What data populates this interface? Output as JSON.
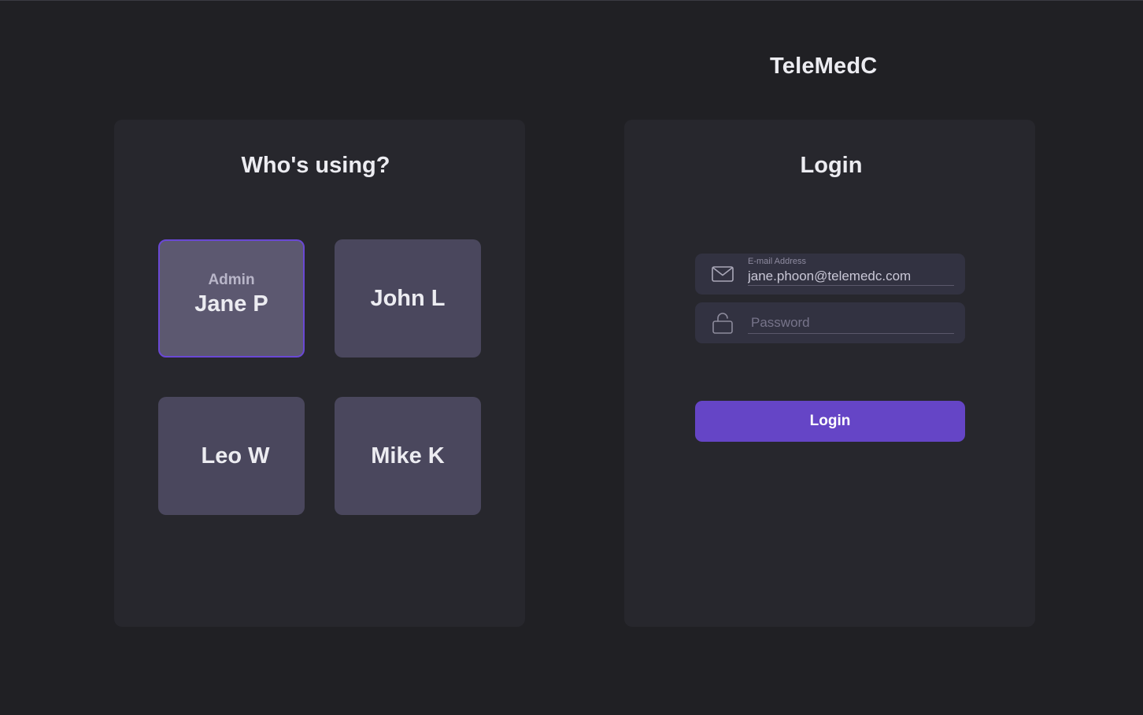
{
  "app": {
    "brand": "TeleMedC"
  },
  "profiles_panel": {
    "title": "Who's using?",
    "profiles": [
      {
        "role": "Admin",
        "name": "Jane P",
        "selected": true
      },
      {
        "role": "",
        "name": "John L",
        "selected": false
      },
      {
        "role": "",
        "name": "Leo W",
        "selected": false
      },
      {
        "role": "",
        "name": "Mike K",
        "selected": false
      }
    ]
  },
  "login_panel": {
    "title": "Login",
    "email": {
      "label": "E-mail Address",
      "value": "jane.phoon@telemedc.com",
      "icon": "envelope-icon"
    },
    "password": {
      "placeholder": "Password",
      "value": "",
      "icon": "unlock-icon"
    },
    "button_label": "Login"
  },
  "colors": {
    "background": "#202024",
    "panel": "#27272d",
    "tile": "#4a475d",
    "tile_selected": "#5c5870",
    "accent": "#6545c6",
    "field": "#323241"
  }
}
